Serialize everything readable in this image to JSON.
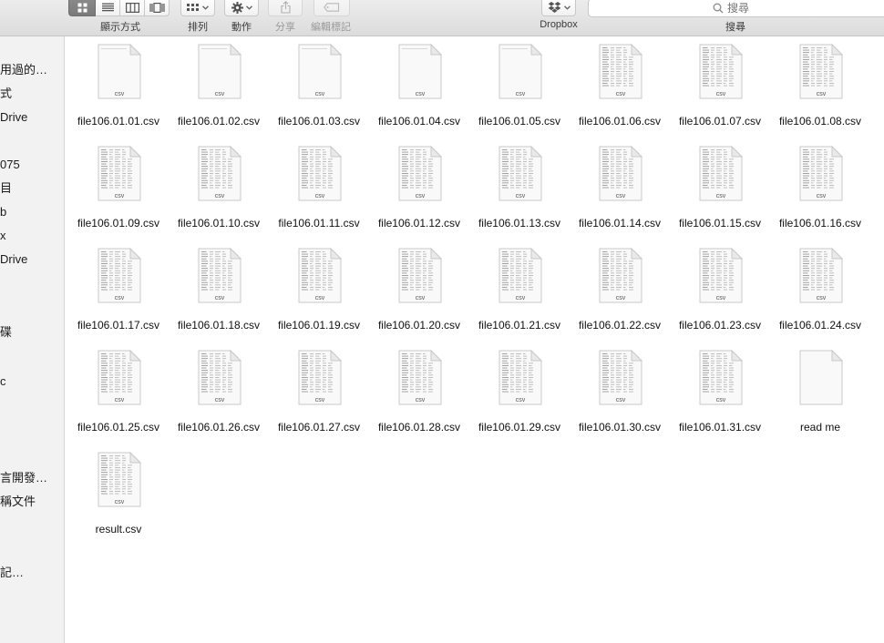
{
  "toolbar": {
    "view_label": "顯示方式",
    "arrange_label": "排列",
    "action_label": "動作",
    "share_label": "分享",
    "tags_label": "編輯標記",
    "dropbox_label": "Dropbox",
    "search_label": "搜尋",
    "search_placeholder": "搜尋",
    "active_view": "icon"
  },
  "sidebar": {
    "items": [
      {
        "label": "用過的…"
      },
      {
        "label": "式"
      },
      {
        "label": "Drive"
      },
      {
        "label": "075"
      },
      {
        "label": "目"
      },
      {
        "label": "b"
      },
      {
        "label": "x"
      },
      {
        "label": "Drive"
      },
      {
        "label": "碟"
      },
      {
        "label": "c"
      },
      {
        "label": "言開發…"
      },
      {
        "label": "稱文件"
      },
      {
        "label": "記…"
      }
    ]
  },
  "files": [
    {
      "name": "file106.01.01.csv",
      "ext": "csv",
      "preview": "blank"
    },
    {
      "name": "file106.01.02.csv",
      "ext": "csv",
      "preview": "blank"
    },
    {
      "name": "file106.01.03.csv",
      "ext": "csv",
      "preview": "blank"
    },
    {
      "name": "file106.01.04.csv",
      "ext": "csv",
      "preview": "blank"
    },
    {
      "name": "file106.01.05.csv",
      "ext": "csv",
      "preview": "blank"
    },
    {
      "name": "file106.01.06.csv",
      "ext": "csv",
      "preview": "table"
    },
    {
      "name": "file106.01.07.csv",
      "ext": "csv",
      "preview": "table"
    },
    {
      "name": "file106.01.08.csv",
      "ext": "csv",
      "preview": "table"
    },
    {
      "name": "file106.01.09.csv",
      "ext": "csv",
      "preview": "table"
    },
    {
      "name": "file106.01.10.csv",
      "ext": "csv",
      "preview": "table"
    },
    {
      "name": "file106.01.11.csv",
      "ext": "csv",
      "preview": "table"
    },
    {
      "name": "file106.01.12.csv",
      "ext": "csv",
      "preview": "table"
    },
    {
      "name": "file106.01.13.csv",
      "ext": "csv",
      "preview": "table"
    },
    {
      "name": "file106.01.14.csv",
      "ext": "csv",
      "preview": "table"
    },
    {
      "name": "file106.01.15.csv",
      "ext": "csv",
      "preview": "table"
    },
    {
      "name": "file106.01.16.csv",
      "ext": "csv",
      "preview": "table"
    },
    {
      "name": "file106.01.17.csv",
      "ext": "csv",
      "preview": "table"
    },
    {
      "name": "file106.01.18.csv",
      "ext": "csv",
      "preview": "table"
    },
    {
      "name": "file106.01.19.csv",
      "ext": "csv",
      "preview": "table"
    },
    {
      "name": "file106.01.20.csv",
      "ext": "csv",
      "preview": "table"
    },
    {
      "name": "file106.01.21.csv",
      "ext": "csv",
      "preview": "table"
    },
    {
      "name": "file106.01.22.csv",
      "ext": "csv",
      "preview": "table"
    },
    {
      "name": "file106.01.23.csv",
      "ext": "csv",
      "preview": "table"
    },
    {
      "name": "file106.01.24.csv",
      "ext": "csv",
      "preview": "table"
    },
    {
      "name": "file106.01.25.csv",
      "ext": "csv",
      "preview": "table"
    },
    {
      "name": "file106.01.26.csv",
      "ext": "csv",
      "preview": "table"
    },
    {
      "name": "file106.01.27.csv",
      "ext": "csv",
      "preview": "table"
    },
    {
      "name": "file106.01.28.csv",
      "ext": "csv",
      "preview": "table"
    },
    {
      "name": "file106.01.29.csv",
      "ext": "csv",
      "preview": "table"
    },
    {
      "name": "file106.01.30.csv",
      "ext": "csv",
      "preview": "table"
    },
    {
      "name": "file106.01.31.csv",
      "ext": "csv",
      "preview": "table"
    },
    {
      "name": "read me",
      "ext": "",
      "preview": "blank"
    },
    {
      "name": "result.csv",
      "ext": "csv",
      "preview": "table"
    }
  ]
}
